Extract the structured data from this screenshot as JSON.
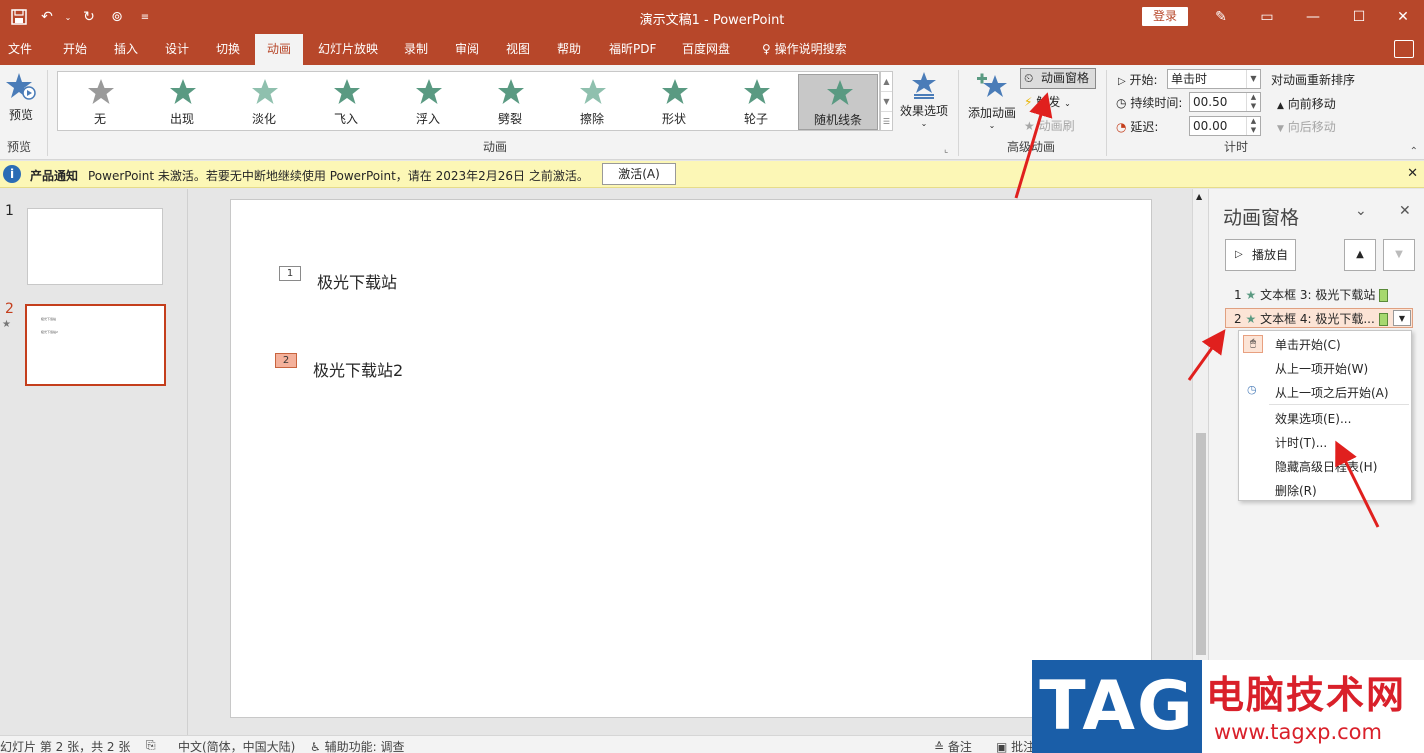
{
  "title_bar": {
    "title": "演示文稿1  -  PowerPoint",
    "login": "登录"
  },
  "tabs": [
    "文件",
    "开始",
    "插入",
    "设计",
    "切换",
    "动画",
    "幻灯片放映",
    "录制",
    "审阅",
    "视图",
    "帮助",
    "福昕PDF",
    "百度网盘",
    "操作说明搜索"
  ],
  "active_tab": "动画",
  "ribbon": {
    "preview": {
      "label": "预览",
      "group": "预览"
    },
    "animation_gallery": {
      "group": "动画",
      "items": [
        "无",
        "出现",
        "淡化",
        "飞入",
        "浮入",
        "劈裂",
        "擦除",
        "形状",
        "轮子",
        "随机线条"
      ],
      "selected": "随机线条"
    },
    "effect_options": "效果选项",
    "advanced": {
      "group": "高级动画",
      "add_animation": "添加动画",
      "animation_pane": "动画窗格",
      "trigger": "触发",
      "animation_painter": "动画刷"
    },
    "timing": {
      "group": "计时",
      "start_label": "开始:",
      "start_value": "单击时",
      "duration_label": "持续时间:",
      "duration_value": "00.50",
      "delay_label": "延迟:",
      "delay_value": "00.00",
      "reorder_title": "对动画重新排序",
      "move_earlier": "向前移动",
      "move_later": "向后移动"
    }
  },
  "notification": {
    "title": "产品通知",
    "message": "PowerPoint 未激活。若要无中断地继续使用 PowerPoint，请在 2023年2月26日 之前激活。",
    "button": "激活(A)"
  },
  "slides_panel": {
    "thumbs": [
      {
        "number": "1"
      },
      {
        "number": "2",
        "preview_lines": [
          "极光下载站",
          "极光下载站2"
        ]
      }
    ]
  },
  "slide": {
    "items": [
      {
        "tag": "1",
        "text": "极光下载站"
      },
      {
        "tag": "2",
        "text": "极光下载站2"
      }
    ]
  },
  "animation_pane": {
    "title": "动画窗格",
    "play_button": "播放自",
    "items": [
      {
        "number": "1",
        "label": "文本框 3: 极光下载站"
      },
      {
        "number": "2",
        "label": "文本框 4: 极光下载..."
      }
    ],
    "context_menu": [
      "单击开始(C)",
      "从上一项开始(W)",
      "从上一项之后开始(A)",
      "效果选项(E)...",
      "计时(T)...",
      "隐藏高级日程表(H)",
      "删除(R)"
    ]
  },
  "status_bar": {
    "slide_info": "幻灯片 第 2 张，共 2 张",
    "language": "中文(简体，中国大陆)",
    "accessibility": "辅助功能: 调查",
    "notes": "备注",
    "comments": "批注"
  },
  "watermark": {
    "logo": "TAG",
    "name": "电脑技术网",
    "url": "www.tagxp.com"
  },
  "colors": {
    "accent": "#b7472a",
    "selected_slide_border": "#c43e1c",
    "notification_bg": "#fcf7b6",
    "star_green": "#5a9a82"
  }
}
